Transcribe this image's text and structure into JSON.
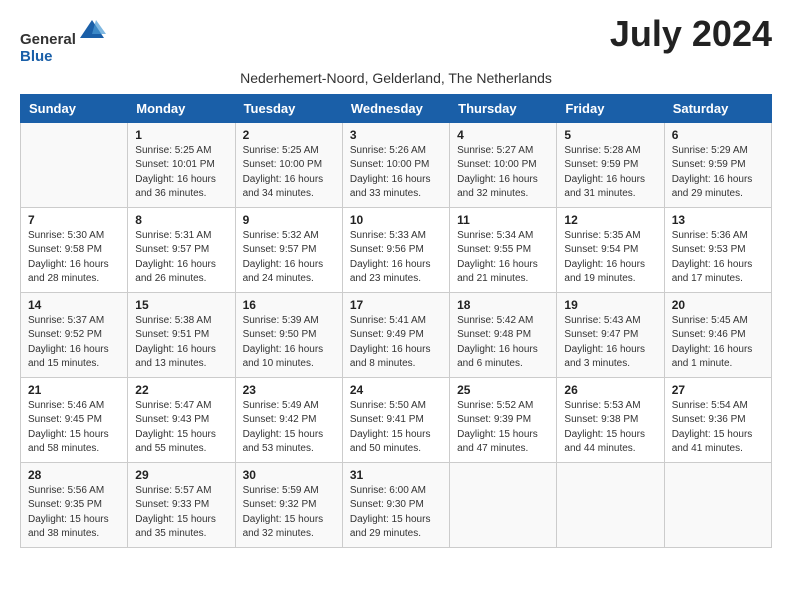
{
  "header": {
    "logo_general": "General",
    "logo_blue": "Blue",
    "month_title": "July 2024",
    "subtitle": "Nederhemert-Noord, Gelderland, The Netherlands"
  },
  "weekdays": [
    "Sunday",
    "Monday",
    "Tuesday",
    "Wednesday",
    "Thursday",
    "Friday",
    "Saturday"
  ],
  "weeks": [
    [
      {
        "day": "",
        "content": ""
      },
      {
        "day": "1",
        "content": "Sunrise: 5:25 AM\nSunset: 10:01 PM\nDaylight: 16 hours\nand 36 minutes."
      },
      {
        "day": "2",
        "content": "Sunrise: 5:25 AM\nSunset: 10:00 PM\nDaylight: 16 hours\nand 34 minutes."
      },
      {
        "day": "3",
        "content": "Sunrise: 5:26 AM\nSunset: 10:00 PM\nDaylight: 16 hours\nand 33 minutes."
      },
      {
        "day": "4",
        "content": "Sunrise: 5:27 AM\nSunset: 10:00 PM\nDaylight: 16 hours\nand 32 minutes."
      },
      {
        "day": "5",
        "content": "Sunrise: 5:28 AM\nSunset: 9:59 PM\nDaylight: 16 hours\nand 31 minutes."
      },
      {
        "day": "6",
        "content": "Sunrise: 5:29 AM\nSunset: 9:59 PM\nDaylight: 16 hours\nand 29 minutes."
      }
    ],
    [
      {
        "day": "7",
        "content": "Sunrise: 5:30 AM\nSunset: 9:58 PM\nDaylight: 16 hours\nand 28 minutes."
      },
      {
        "day": "8",
        "content": "Sunrise: 5:31 AM\nSunset: 9:57 PM\nDaylight: 16 hours\nand 26 minutes."
      },
      {
        "day": "9",
        "content": "Sunrise: 5:32 AM\nSunset: 9:57 PM\nDaylight: 16 hours\nand 24 minutes."
      },
      {
        "day": "10",
        "content": "Sunrise: 5:33 AM\nSunset: 9:56 PM\nDaylight: 16 hours\nand 23 minutes."
      },
      {
        "day": "11",
        "content": "Sunrise: 5:34 AM\nSunset: 9:55 PM\nDaylight: 16 hours\nand 21 minutes."
      },
      {
        "day": "12",
        "content": "Sunrise: 5:35 AM\nSunset: 9:54 PM\nDaylight: 16 hours\nand 19 minutes."
      },
      {
        "day": "13",
        "content": "Sunrise: 5:36 AM\nSunset: 9:53 PM\nDaylight: 16 hours\nand 17 minutes."
      }
    ],
    [
      {
        "day": "14",
        "content": "Sunrise: 5:37 AM\nSunset: 9:52 PM\nDaylight: 16 hours\nand 15 minutes."
      },
      {
        "day": "15",
        "content": "Sunrise: 5:38 AM\nSunset: 9:51 PM\nDaylight: 16 hours\nand 13 minutes."
      },
      {
        "day": "16",
        "content": "Sunrise: 5:39 AM\nSunset: 9:50 PM\nDaylight: 16 hours\nand 10 minutes."
      },
      {
        "day": "17",
        "content": "Sunrise: 5:41 AM\nSunset: 9:49 PM\nDaylight: 16 hours\nand 8 minutes."
      },
      {
        "day": "18",
        "content": "Sunrise: 5:42 AM\nSunset: 9:48 PM\nDaylight: 16 hours\nand 6 minutes."
      },
      {
        "day": "19",
        "content": "Sunrise: 5:43 AM\nSunset: 9:47 PM\nDaylight: 16 hours\nand 3 minutes."
      },
      {
        "day": "20",
        "content": "Sunrise: 5:45 AM\nSunset: 9:46 PM\nDaylight: 16 hours\nand 1 minute."
      }
    ],
    [
      {
        "day": "21",
        "content": "Sunrise: 5:46 AM\nSunset: 9:45 PM\nDaylight: 15 hours\nand 58 minutes."
      },
      {
        "day": "22",
        "content": "Sunrise: 5:47 AM\nSunset: 9:43 PM\nDaylight: 15 hours\nand 55 minutes."
      },
      {
        "day": "23",
        "content": "Sunrise: 5:49 AM\nSunset: 9:42 PM\nDaylight: 15 hours\nand 53 minutes."
      },
      {
        "day": "24",
        "content": "Sunrise: 5:50 AM\nSunset: 9:41 PM\nDaylight: 15 hours\nand 50 minutes."
      },
      {
        "day": "25",
        "content": "Sunrise: 5:52 AM\nSunset: 9:39 PM\nDaylight: 15 hours\nand 47 minutes."
      },
      {
        "day": "26",
        "content": "Sunrise: 5:53 AM\nSunset: 9:38 PM\nDaylight: 15 hours\nand 44 minutes."
      },
      {
        "day": "27",
        "content": "Sunrise: 5:54 AM\nSunset: 9:36 PM\nDaylight: 15 hours\nand 41 minutes."
      }
    ],
    [
      {
        "day": "28",
        "content": "Sunrise: 5:56 AM\nSunset: 9:35 PM\nDaylight: 15 hours\nand 38 minutes."
      },
      {
        "day": "29",
        "content": "Sunrise: 5:57 AM\nSunset: 9:33 PM\nDaylight: 15 hours\nand 35 minutes."
      },
      {
        "day": "30",
        "content": "Sunrise: 5:59 AM\nSunset: 9:32 PM\nDaylight: 15 hours\nand 32 minutes."
      },
      {
        "day": "31",
        "content": "Sunrise: 6:00 AM\nSunset: 9:30 PM\nDaylight: 15 hours\nand 29 minutes."
      },
      {
        "day": "",
        "content": ""
      },
      {
        "day": "",
        "content": ""
      },
      {
        "day": "",
        "content": ""
      }
    ]
  ]
}
